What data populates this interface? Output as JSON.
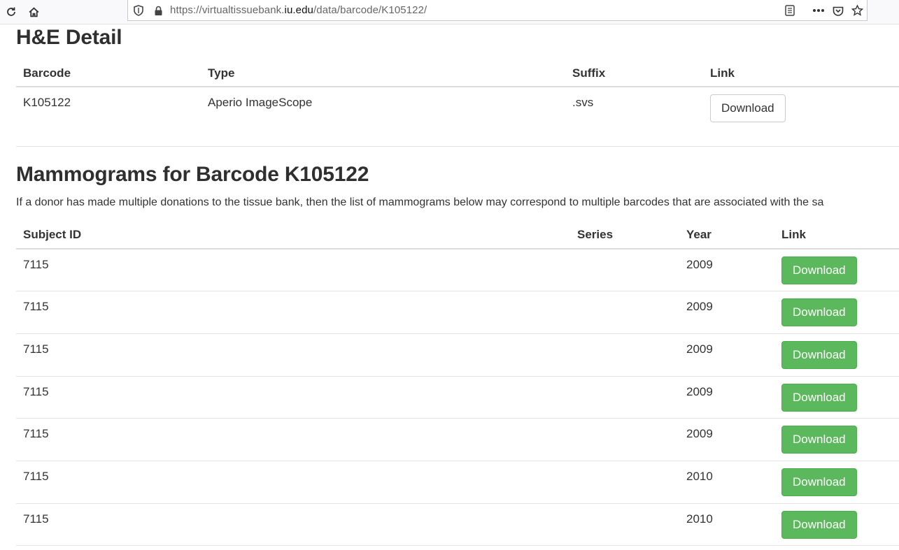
{
  "browser": {
    "url_prefix": "https://virtualtissuebank.",
    "url_domain": "iu.edu",
    "url_path": "/data/barcode/K105122/"
  },
  "he_section": {
    "title": "H&E Detail",
    "headers": [
      "Barcode",
      "Type",
      "Suffix",
      "Link"
    ],
    "rows": [
      {
        "barcode": "K105122",
        "type": "Aperio ImageScope",
        "suffix": ".svs",
        "link_label": "Download"
      }
    ]
  },
  "mammogram_section": {
    "title": "Mammograms for Barcode K105122",
    "intro": "If a donor has made multiple donations to the tissue bank, then the list of mammograms below may correspond to multiple barcodes that are associated with the sa",
    "headers": [
      "Subject ID",
      "Series",
      "Year",
      "Link"
    ],
    "rows": [
      {
        "subject_id": "7115",
        "series": "",
        "year": "2009",
        "link_label": "Download"
      },
      {
        "subject_id": "7115",
        "series": "",
        "year": "2009",
        "link_label": "Download"
      },
      {
        "subject_id": "7115",
        "series": "",
        "year": "2009",
        "link_label": "Download"
      },
      {
        "subject_id": "7115",
        "series": "",
        "year": "2009",
        "link_label": "Download"
      },
      {
        "subject_id": "7115",
        "series": "",
        "year": "2009",
        "link_label": "Download"
      },
      {
        "subject_id": "7115",
        "series": "",
        "year": "2010",
        "link_label": "Download"
      },
      {
        "subject_id": "7115",
        "series": "",
        "year": "2010",
        "link_label": "Download"
      }
    ]
  },
  "colors": {
    "success_button": "#5cb85c",
    "heading_text": "#2f2f2f"
  },
  "icons": [
    "reload-icon",
    "home-icon",
    "shield-icon",
    "lock-icon",
    "reader-view-icon",
    "more-icon",
    "pocket-icon",
    "bookmark-star-icon"
  ]
}
